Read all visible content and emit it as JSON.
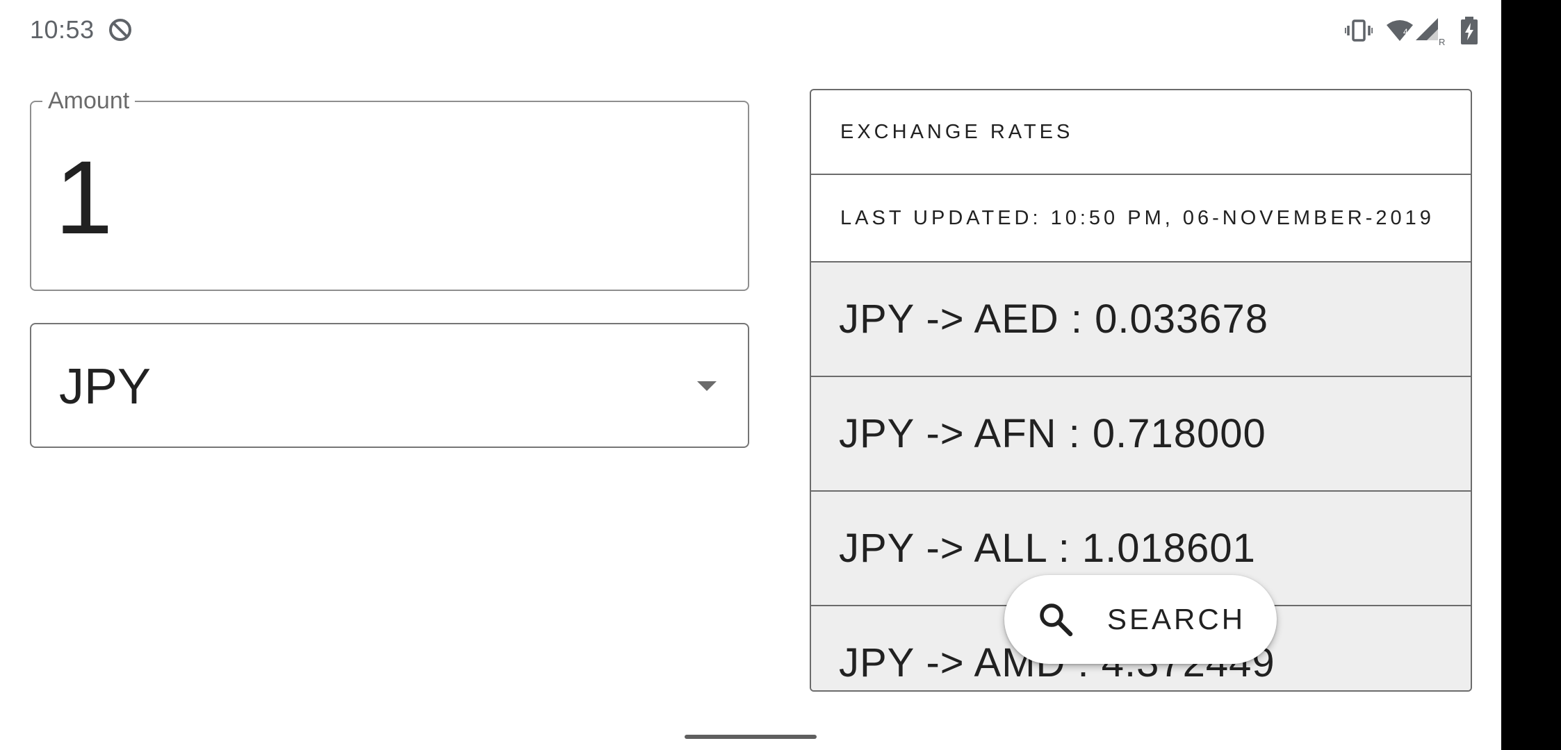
{
  "status_bar": {
    "time": "10:53",
    "icons": [
      "data-saver-icon",
      "vibrate-icon",
      "wifi-icon",
      "signal-icon",
      "battery-charging-icon"
    ],
    "wifi_badge": "4",
    "roaming_badge": "R"
  },
  "amount": {
    "label": "Amount",
    "value": "1"
  },
  "currency_select": {
    "selected": "JPY"
  },
  "rates": {
    "header": "EXCHANGE RATES",
    "last_updated": "LAST UPDATED: 10:50 PM, 06-NOVEMBER-2019",
    "items": [
      {
        "label": "JPY -> AED : 0.033678"
      },
      {
        "label": "JPY -> AFN : 0.718000"
      },
      {
        "label": "JPY -> ALL : 1.018601"
      },
      {
        "label": "JPY -> AMD : 4.372449"
      }
    ]
  },
  "search_button": {
    "label": "SEARCH",
    "icon": "search-icon"
  },
  "colors": {
    "row_background": "#eeeeee",
    "border": "#6b6b6b",
    "text": "#212121"
  }
}
